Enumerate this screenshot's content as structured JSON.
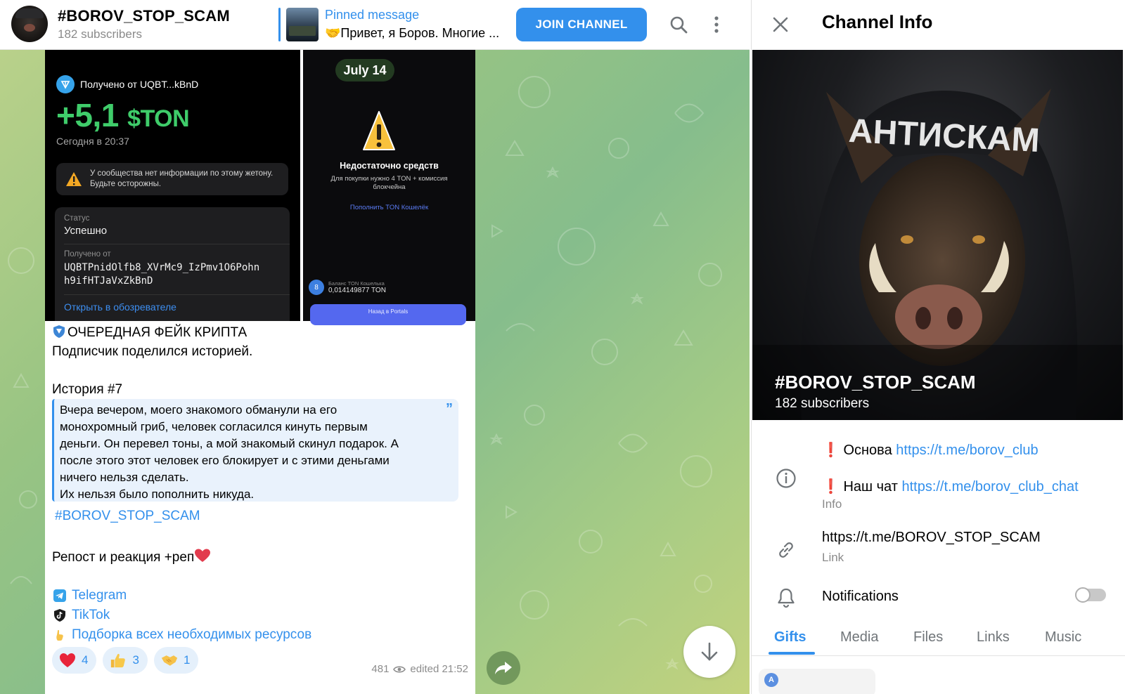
{
  "header": {
    "channel_name": "#BOROV_STOP_SCAM",
    "subscribers": "182 subscribers",
    "pinned_label": "Pinned message",
    "pinned_text": "🤝Привет, я Боров. Многие ...",
    "join_label": "JOIN CHANNEL",
    "icons": [
      "search-icon",
      "more-vertical-icon"
    ]
  },
  "message": {
    "left_shot": {
      "received_from": "Получено от UQBT...kBnD",
      "amount": "+5,1",
      "amount_symbol": "$TON",
      "date": "Сегодня в 20:37",
      "warning": "У сообщества нет информации по этому жетону. Будьте осторожны.",
      "status_label": "Статус",
      "status_value": "Успешно",
      "from_label": "Получено от",
      "from_address_1": "UQBTPnidOlfb8_XVrMc9_IzPmv1O6Pohn",
      "from_address_2": "h9ifHTJaVxZkBnD",
      "explorer_link": "Открыть в обозревателе"
    },
    "right_shot": {
      "date_badge": "July 14",
      "title": "Недостаточно средств",
      "subtitle": "Для покупки нужно 4 TON + комиссия блокчейна",
      "topup_link": "Пополнить TON Кошелёк",
      "balance_label": "Баланс TON Кошелька",
      "balance_value": "0,014149877 TON",
      "bottom_button": "Назад в Portals"
    },
    "line1": "ОЧЕРЕДНАЯ ФЕЙК КРИПТА",
    "line2": "Подписчик поделился историей.",
    "story_title": "История #7",
    "quote_lines": [
      "Вчера вечером, моего знакомого обманули на его",
      "монохромный гриб, человек согласился кинуть первым",
      "деньги. Он перевел тоны, а мой знакомый скинул подарок. А",
      "после этого этот человек его блокирует и с этими деньгами",
      "ничего нельзя сделать.",
      "Их нельзя было пополнить никуда."
    ],
    "hashtag": "#BOROV_STOP_SCAM",
    "repost": "Репост и реакция +реп",
    "links": [
      "Telegram",
      "TikTok",
      "Подборка всех необходимых ресурсов"
    ],
    "reactions": [
      {
        "emoji": "heart",
        "count": "4"
      },
      {
        "emoji": "thumbs-up",
        "count": "3"
      },
      {
        "emoji": "handshake",
        "count": "1"
      }
    ],
    "views": "481",
    "edited": "edited 21:52"
  },
  "panel": {
    "title": "Channel Info",
    "cover_text": "АНТИСКАМ",
    "channel_name": "#BOROV_STOP_SCAM",
    "subscribers": "182 subscribers",
    "info_line1_prefix": "❗ Основа ",
    "info_line1_link": "https://t.me/borov_club",
    "info_line2_prefix": "❗ Наш чат ",
    "info_line2_link": "https://t.me/borov_club_chat",
    "info_label": "Info",
    "link_value": "https://t.me/BOROV_STOP_SCAM",
    "link_label": "Link",
    "notifications_label": "Notifications",
    "notifications_on": false,
    "tabs": [
      "Gifts",
      "Media",
      "Files",
      "Links",
      "Music"
    ],
    "active_tab": "Gifts"
  },
  "colors": {
    "accent": "#3390ec",
    "ton_green": "#3fcc6a"
  }
}
